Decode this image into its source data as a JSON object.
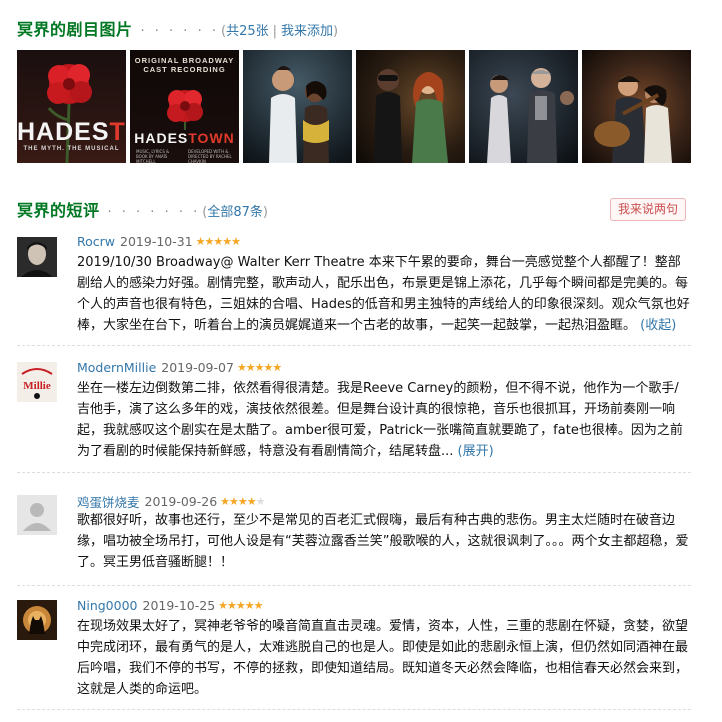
{
  "photos_section": {
    "title": "冥界的剧目图片",
    "dots": "· · · · · ·",
    "paren_open": "(",
    "count_label": "共25张",
    "separator": "|",
    "add_label": "我来添加",
    "paren_close": ")",
    "photos": [
      {
        "icon": "hadestown-poster-red-flower"
      },
      {
        "icon": "hadestown-cast-recording-cover"
      },
      {
        "icon": "stage-photo-couple"
      },
      {
        "icon": "stage-photo-hades-persephone"
      },
      {
        "icon": "stage-photo-ensemble"
      },
      {
        "icon": "stage-photo-guitar-embrace"
      }
    ],
    "poster1": {
      "word_left": "HADES",
      "word_right": "TOWN",
      "sub": "THE MYTH. THE MUSICAL"
    },
    "poster2": {
      "top_line1": "ORIGINAL BROADWAY",
      "top_line2": "CAST RECORDING",
      "word_left": "HADES",
      "word_right": "TOWN",
      "credits_left": "MUSIC, LYRICS & BOOK BY ANAÏS MITCHELL",
      "credits_right": "DEVELOPED WITH & DIRECTED BY RACHEL CHAVKIN"
    }
  },
  "reviews_section": {
    "title": "冥界的短评",
    "dots": "· · · · · · ·",
    "paren_open": "(",
    "all_label": "全部87条",
    "paren_close": ")",
    "add_button": "我来说两句"
  },
  "reviews": [
    {
      "user": "Rocrw",
      "date": "2019-10-31",
      "rating": 5,
      "text": "2019/10/30 Broadway@ Walter Kerr Theatre 本来下午累的要命，舞台一亮感觉整个人都醒了！整部剧给人的感染力好强。剧情完整，歌声动人，配乐出色，布景更是锦上添花，几乎每个瞬间都是完美的。每个人的声音也很有特色，三姐妹的合唱、Hades的低音和男主独特的声线给人的印象很深刻。观众气氛也好棒，大家坐在台下，听着台上的演员娓娓道来一个古老的故事，一起笑一起鼓掌，一起热泪盈眶。",
      "toggle": "(收起)"
    },
    {
      "user": "ModernMillie",
      "date": "2019-09-07",
      "rating": 5,
      "text": "坐在一楼左边倒数第二排，依然看得很清楚。我是Reeve Carney的颜粉，但不得不说，他作为一个歌手/吉他手，演了这么多年的戏，演技依然很差。但是舞台设计真的很惊艳，音乐也很抓耳，开场前奏刚一响起，我就感叹这个剧实在是太酷了。amber很可爱，Patrick一张嘴简直就要跪了，fate也很棒。因为之前为了看剧的时候能保持新鲜感，特意没有看剧情简介，结尾转盘...",
      "toggle": "(展开)"
    },
    {
      "user": "鸡蛋饼烧麦",
      "date": "2019-09-26",
      "rating": 4,
      "text": "歌都很好听，故事也还行，至少不是常见的百老汇式假嗨，最后有种古典的悲伤。男主太烂随时在破音边缘，唱功被全场吊打，可他人设是有“芙蓉泣露香兰笑”般歌喉的人，这就很讽刺了。。。两个女主都超稳，爱了。冥王男低音骚断腿！！",
      "toggle": ""
    },
    {
      "user": "Ning0000",
      "date": "2019-10-25",
      "rating": 5,
      "text": "在现场效果太好了，冥神老爷爷的嗓音简直直击灵魂。爱情，资本，人性，三重的悲剧在怀疑，贪婪，欲望中完成闭环，最有勇气的是人，太难逃脱自己的也是人。即使是如此的悲剧永恒上演，但仍然如同酒神在最后吟唱，我们不停的书写，不停的拯救，即使知道结局。既知道冬天必然会降临，也相信春天必然会来到，这就是人类的命运吧。",
      "toggle": ""
    }
  ],
  "colors": {
    "section_title": "#007722",
    "link": "#3377aa",
    "star": "#f5a623"
  }
}
